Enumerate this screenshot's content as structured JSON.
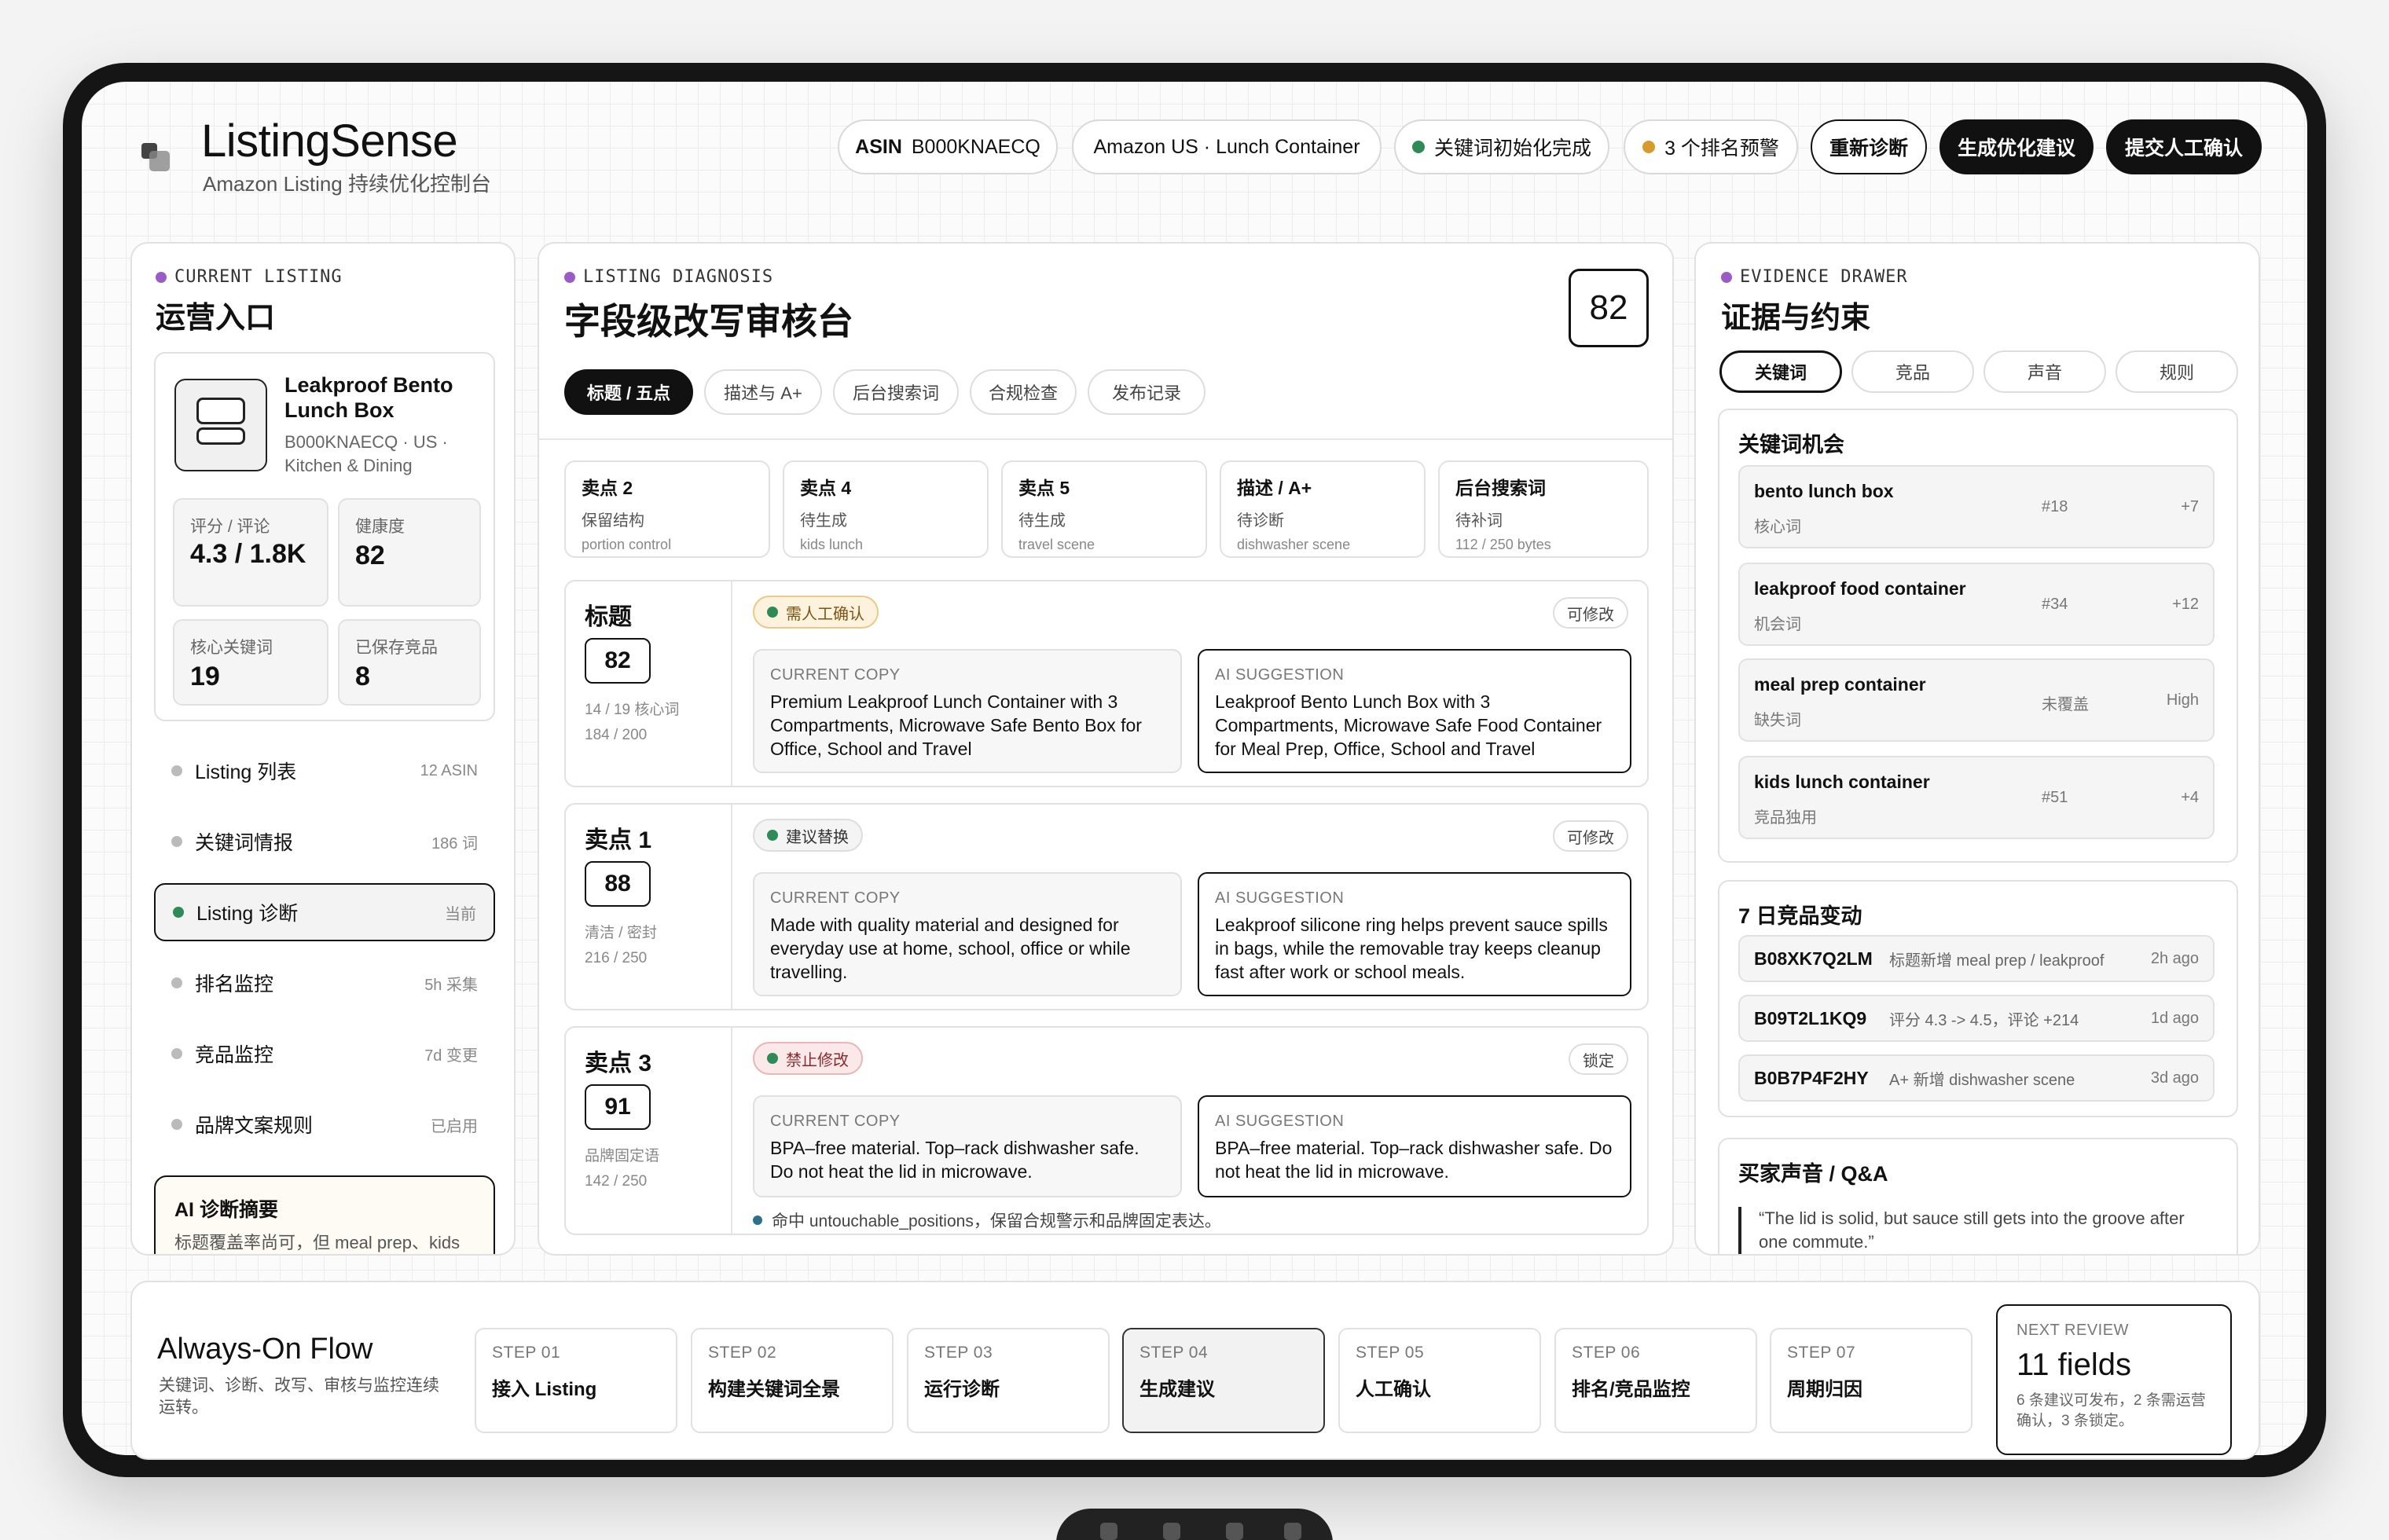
{
  "app": {
    "name": "ListingSense",
    "subtitle": "Amazon Listing 持续优化控制台"
  },
  "header": {
    "asin_label": "ASIN",
    "asin": "B000KNAECQ",
    "marketplace": "Amazon US · Lunch Container",
    "status1": "关键词初始化完成",
    "status2": "3 个排名预警",
    "btn_rediagnose": "重新诊断",
    "btn_generate": "生成优化建议",
    "btn_submit": "提交人工确认"
  },
  "colors": {
    "green": "#2e8b57",
    "amber": "#d89a2a",
    "purple": "#9a5cc4",
    "red": "#c0392b"
  },
  "left": {
    "kicker": "CURRENT LISTING",
    "title": "运营入口",
    "product": {
      "name": "Leakproof Bento Lunch Box",
      "meta": "B000KNAECQ · US · Kitchen & Dining"
    },
    "stats": [
      {
        "label": "评分 / 评论",
        "value": "4.3 / 1.8K"
      },
      {
        "label": "健康度",
        "value": "82"
      },
      {
        "label": "核心关键词",
        "value": "19"
      },
      {
        "label": "已保存竞品",
        "value": "8"
      }
    ],
    "nav": [
      {
        "label": "Listing 列表",
        "count": "12 ASIN"
      },
      {
        "label": "关键词情报",
        "count": "186 词"
      },
      {
        "label": "Listing 诊断",
        "count": "当前"
      },
      {
        "label": "排名监控",
        "count": "5h 采集"
      },
      {
        "label": "竞品监控",
        "count": "7d 变更"
      },
      {
        "label": "品牌文案规则",
        "count": "已启用"
      }
    ],
    "summary": {
      "title": "AI 诊断摘要",
      "text": "标题覆盖率尚可，但 meal prep、kids"
    }
  },
  "center": {
    "kicker": "LISTING DIAGNOSIS",
    "title": "字段级改写审核台",
    "score": "82",
    "tabs": [
      "标题 / 五点",
      "描述与 A+",
      "后台搜索词",
      "合规检查",
      "发布记录"
    ],
    "cards": [
      {
        "t": "卖点 2",
        "s": "保留结构",
        "e": "portion control"
      },
      {
        "t": "卖点 4",
        "s": "待生成",
        "e": "kids lunch"
      },
      {
        "t": "卖点 5",
        "s": "待生成",
        "e": "travel scene"
      },
      {
        "t": "描述 / A+",
        "s": "待诊断",
        "e": "dishwasher scene"
      },
      {
        "t": "后台搜索词",
        "s": "待补词",
        "e": "112 / 250 bytes"
      }
    ],
    "fields": [
      {
        "name": "标题",
        "score": "82",
        "m1": "14 / 19 核心词",
        "m2": "184 / 200",
        "badge": "需人工确认",
        "action": "可修改",
        "cur_label": "CURRENT COPY",
        "cur": "Premium Leakproof Lunch Container with 3 Compartments, Microwave Safe Bento Box for Office, School and Travel",
        "ai_label": "AI SUGGESTION",
        "ai": "Leakproof Bento Lunch Box with 3 Compartments, Microwave Safe Food Container for Meal Prep, Office, School and Travel"
      },
      {
        "name": "卖点 1",
        "score": "88",
        "m1": "清洁 / 密封",
        "m2": "216 / 250",
        "badge": "建议替换",
        "action": "可修改",
        "cur_label": "CURRENT COPY",
        "cur": "Made with quality material and designed for everyday use at home, school, office or while travelling.",
        "ai_label": "AI SUGGESTION",
        "ai": "Leakproof silicone ring helps prevent sauce spills in bags, while the removable tray keeps cleanup fast after work or school meals."
      },
      {
        "name": "卖点 3",
        "score": "91",
        "m1": "品牌固定语",
        "m2": "142 / 250",
        "badge": "禁止修改",
        "action": "锁定",
        "cur_label": "CURRENT COPY",
        "cur": "BPA–free material. Top–rack dishwasher safe. Do not heat the lid in microwave.",
        "ai_label": "AI SUGGESTION",
        "ai": "BPA–free material. Top–rack dishwasher safe. Do not heat the lid in microwave."
      }
    ],
    "note": "命中 untouchable_positions，保留合规警示和品牌固定表达。"
  },
  "right": {
    "kicker": "EVIDENCE DRAWER",
    "title": "证据与约束",
    "tabs": [
      "关键词",
      "竞品",
      "声音",
      "规则"
    ],
    "kw_title": "关键词机会",
    "keywords": [
      {
        "k": "bento lunch box",
        "t": "核心词",
        "r": "#18",
        "d": "+7"
      },
      {
        "k": "leakproof food container",
        "t": "机会词",
        "r": "#34",
        "d": "+12"
      },
      {
        "k": "meal prep container",
        "t": "缺失词",
        "r": "未覆盖",
        "d": "High"
      },
      {
        "k": "kids lunch container",
        "t": "竞品独用",
        "r": "#51",
        "d": "+4"
      }
    ],
    "comp_title": "7 日竞品变动",
    "competitors": [
      {
        "a": "B08XK7Q2LM",
        "c": "标题新增 meal prep / leakproof",
        "t": "2h ago"
      },
      {
        "a": "B09T2L1KQ9",
        "c": "评分 4.3 -> 4.5，评论 +214",
        "t": "1d ago"
      },
      {
        "a": "B0B7P4F2HY",
        "c": "A+ 新增 dishwasher scene",
        "t": "3d ago"
      }
    ],
    "voice_title": "买家声音 / Q&A",
    "quote": "“The lid is solid, but sauce still gets into the groove after one commute.”"
  },
  "flow": {
    "title": "Always-On Flow",
    "desc": "关键词、诊断、改写、审核与监控连续运转。",
    "steps": [
      {
        "n": "STEP 01",
        "t": "接入 Listing"
      },
      {
        "n": "STEP 02",
        "t": "构建关键词全景"
      },
      {
        "n": "STEP 03",
        "t": "运行诊断"
      },
      {
        "n": "STEP 04",
        "t": "生成建议"
      },
      {
        "n": "STEP 05",
        "t": "人工确认"
      },
      {
        "n": "STEP 06",
        "t": "排名/竞品监控"
      },
      {
        "n": "STEP 07",
        "t": "周期归因"
      }
    ],
    "review": {
      "label": "NEXT REVIEW",
      "value": "11 fields",
      "desc": "6 条建议可发布，2 条需运营确认，3 条锁定。"
    }
  }
}
